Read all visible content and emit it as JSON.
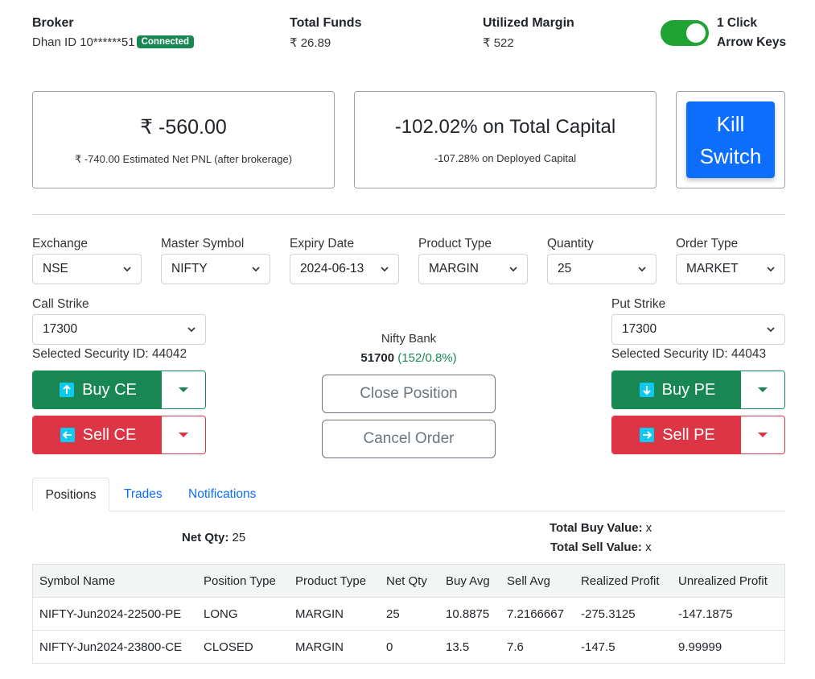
{
  "header": {
    "broker_label": "Broker",
    "broker_id": "Dhan ID 10******51",
    "status_badge": "Connected",
    "funds_label": "Total Funds",
    "funds_value": "₹ 26.89",
    "margin_label": "Utilized Margin",
    "margin_value": "₹ 522",
    "toggle_on": true,
    "toggle_label_1": "1 Click",
    "toggle_label_2": "Arrow Keys"
  },
  "pnl": {
    "amount": "₹ -560.00",
    "net_note": "₹ -740.00 Estimated Net PNL (after brokerage)",
    "pct_total": "-102.02% on Total Capital",
    "pct_deployed": "-107.28% on Deployed Capital"
  },
  "kill_switch": {
    "line1": "Kill",
    "line2": "Switch"
  },
  "form": {
    "exchange_label": "Exchange",
    "exchange_value": "NSE",
    "symbol_label": "Master Symbol",
    "symbol_value": "NIFTY",
    "expiry_label": "Expiry Date",
    "expiry_value": "2024-06-13",
    "product_label": "Product Type",
    "product_value": "MARGIN",
    "qty_label": "Quantity",
    "qty_value": "25",
    "ordertype_label": "Order Type",
    "ordertype_value": "MARKET"
  },
  "call": {
    "strike_label": "Call Strike",
    "strike_value": "17300",
    "security": "Selected Security ID: 44042",
    "buy_label": "Buy CE",
    "sell_label": "Sell CE"
  },
  "put": {
    "strike_label": "Put Strike",
    "strike_value": "17300",
    "security": "Selected Security ID: 44043",
    "buy_label": "Buy PE",
    "sell_label": "Sell PE"
  },
  "index": {
    "name": "Nifty Bank",
    "price": "51700",
    "change": "(152/0.8%)"
  },
  "actions": {
    "close_position": "Close Position",
    "cancel_order": "Cancel Order"
  },
  "tabs": [
    "Positions",
    "Trades",
    "Notifications"
  ],
  "summary": {
    "net_qty_label": "Net Qty:",
    "net_qty_value": "25",
    "buy_value_label": "Total Buy Value:",
    "buy_value": "x",
    "sell_value_label": "Total Sell Value:",
    "sell_value": "x"
  },
  "table": {
    "headers": [
      "Symbol Name",
      "Position Type",
      "Product Type",
      "Net Qty",
      "Buy Avg",
      "Sell Avg",
      "Realized Profit",
      "Unrealized Profit"
    ],
    "rows": [
      [
        "NIFTY-Jun2024-22500-PE",
        "LONG",
        "MARGIN",
        "25",
        "10.8875",
        "7.2166667",
        "-275.3125",
        "-147.1875"
      ],
      [
        "NIFTY-Jun2024-23800-CE",
        "CLOSED",
        "MARGIN",
        "0",
        "13.5",
        "7.6",
        "-147.5",
        "9.99999"
      ]
    ]
  },
  "colors": {
    "success": "#198754",
    "danger": "#dc3545",
    "primary": "#0d6efd",
    "toggle": "#1fa335",
    "change_green": "#198754"
  }
}
